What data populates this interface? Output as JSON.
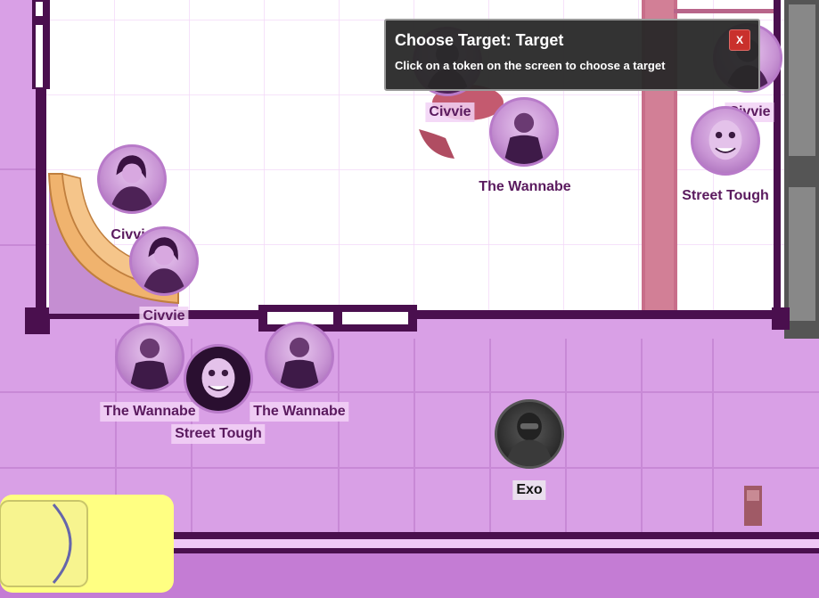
{
  "dialog": {
    "title": "Choose Target: Target",
    "instruction": "Click on a token on the screen to choose a target",
    "close_label": "X"
  },
  "tokens": {
    "civvie_top": "Civvie",
    "wannabe_top": "The Wannabe",
    "civvie_right": "Civvie",
    "street_tough_right": "Street Tough",
    "civvie_left_upper": "Civvie",
    "civvie_left_lower": "Civvie",
    "wannabe_left": "The Wannabe",
    "street_tough_center": "Street Tough",
    "wannabe_center": "The Wannabe",
    "exo": "Exo"
  },
  "colors": {
    "street": "#d9a0e6",
    "room_floor": "#ffffff",
    "wall": "#4a0f4e",
    "dialog_bg": "#282828",
    "close_button": "#c9302c",
    "token_label": "#5a1a5e"
  }
}
